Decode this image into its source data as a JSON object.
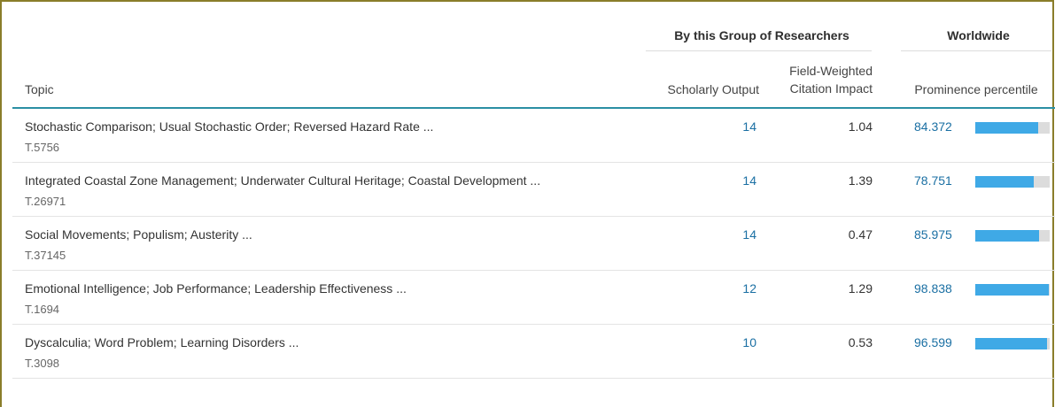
{
  "headers": {
    "group_researchers": "By this Group of Researchers",
    "group_worldwide": "Worldwide",
    "topic": "Topic",
    "scholarly_output": "Scholarly Output",
    "fwci_line1": "Field-Weighted",
    "fwci_line2": "Citation Impact",
    "prominence": "Prominence percentile"
  },
  "colors": {
    "panel_border": "#8a7d2a",
    "header_rule": "#2b8fa4",
    "link_blue": "#1a6fa3",
    "bar_fill": "#3fa9e6",
    "bar_track": "#dcdcdc"
  },
  "rows": [
    {
      "title": "Stochastic Comparison; Usual Stochastic Order; Reversed Hazard Rate ...",
      "code": "T.5756",
      "scholarly_output": "14",
      "fwci": "1.04",
      "prominence": "84.372",
      "prominence_fraction": 0.84372
    },
    {
      "title": "Integrated Coastal Zone Management; Underwater Cultural Heritage; Coastal Development ...",
      "code": "T.26971",
      "scholarly_output": "14",
      "fwci": "1.39",
      "prominence": "78.751",
      "prominence_fraction": 0.78751
    },
    {
      "title": "Social Movements; Populism; Austerity ...",
      "code": "T.37145",
      "scholarly_output": "14",
      "fwci": "0.47",
      "prominence": "85.975",
      "prominence_fraction": 0.85975
    },
    {
      "title": "Emotional Intelligence; Job Performance; Leadership Effectiveness ...",
      "code": "T.1694",
      "scholarly_output": "12",
      "fwci": "1.29",
      "prominence": "98.838",
      "prominence_fraction": 0.98838
    },
    {
      "title": "Dyscalculia; Word Problem; Learning Disorders ...",
      "code": "T.3098",
      "scholarly_output": "10",
      "fwci": "0.53",
      "prominence": "96.599",
      "prominence_fraction": 0.96599
    }
  ]
}
